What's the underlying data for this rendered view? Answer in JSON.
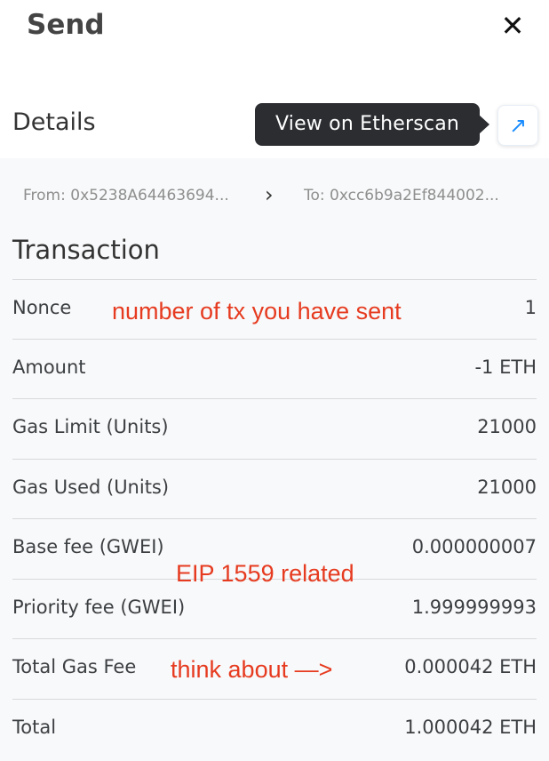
{
  "header": {
    "title": "Send",
    "close_icon": "close-icon"
  },
  "details": {
    "label": "Details",
    "tooltip": "View on Etherscan",
    "external_icon": "external-link-icon"
  },
  "addresses": {
    "from": "From: 0x5238A64463694...",
    "to": "To: 0xcc6b9a2Ef844002..."
  },
  "transaction": {
    "title": "Transaction",
    "rows": [
      {
        "label": "Nonce",
        "value": "1"
      },
      {
        "label": "Amount",
        "value": "-1 ETH"
      },
      {
        "label": "Gas Limit (Units)",
        "value": "21000"
      },
      {
        "label": "Gas Used (Units)",
        "value": "21000"
      },
      {
        "label": "Base fee (GWEI)",
        "value": "0.000000007"
      },
      {
        "label": "Priority fee (GWEI)",
        "value": "1.999999993"
      },
      {
        "label": "Total Gas Fee",
        "value": "0.000042 ETH"
      },
      {
        "label": "Total",
        "value": "1.000042 ETH"
      }
    ]
  },
  "annotations": {
    "nonce_note": "number of tx you have sent",
    "eip_note": "EIP 1559 related",
    "gas_note": "think about —>"
  },
  "colors": {
    "annotation": "#e63b20",
    "accent": "#1a8cff",
    "tooltip_bg": "#2b2d31"
  }
}
